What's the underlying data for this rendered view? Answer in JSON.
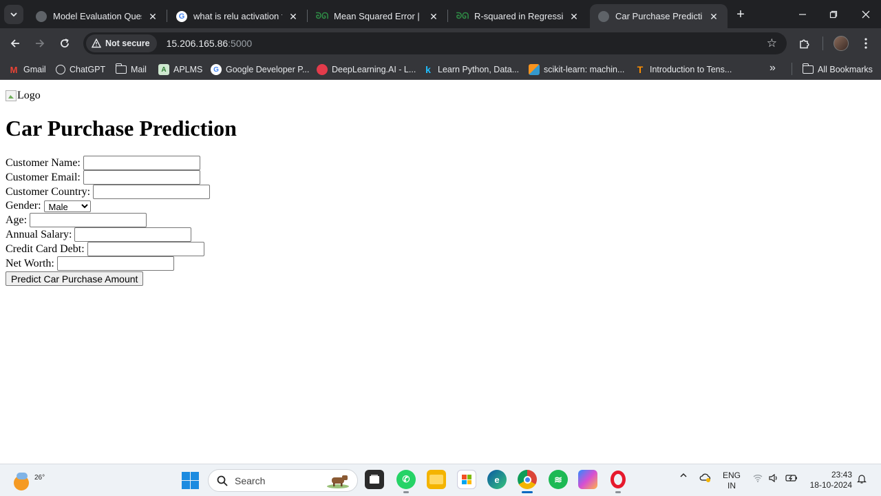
{
  "browser": {
    "tabs": [
      {
        "title": "Model Evaluation Questio",
        "favicon": "globe-icon"
      },
      {
        "title": "what is relu activation fur",
        "favicon": "google-icon"
      },
      {
        "title": "Mean Squared Error | Del",
        "favicon": "geeksforgeeks-icon"
      },
      {
        "title": "R-squared in Regression",
        "favicon": "geeksforgeeks-icon"
      },
      {
        "title": "Car Purchase Prediction",
        "favicon": "globe-icon",
        "active": true
      }
    ],
    "address": {
      "security_label": "Not secure",
      "host": "15.206.165.86",
      "port": ":5000"
    },
    "bookmarks": [
      {
        "label": "Gmail"
      },
      {
        "label": "ChatGPT"
      },
      {
        "label": "Mail"
      },
      {
        "label": "APLMS"
      },
      {
        "label": "Google Developer P..."
      },
      {
        "label": "DeepLearning.AI - L..."
      },
      {
        "label": "Learn Python, Data..."
      },
      {
        "label": "scikit-learn: machin..."
      },
      {
        "label": "Introduction to Tens..."
      }
    ],
    "all_bookmarks_label": "All Bookmarks"
  },
  "page": {
    "logo_alt": "Logo",
    "title": "Car Purchase Prediction",
    "form": {
      "customer_name_label": "Customer Name:",
      "customer_email_label": "Customer Email:",
      "customer_country_label": "Customer Country:",
      "gender_label": "Gender:",
      "gender_selected": "Male",
      "gender_options": [
        "Male"
      ],
      "age_label": "Age:",
      "annual_salary_label": "Annual Salary:",
      "credit_card_debt_label": "Credit Card Debt:",
      "net_worth_label": "Net Worth:",
      "submit_label": "Predict Car Purchase Amount"
    }
  },
  "taskbar": {
    "temperature": "26°",
    "search_placeholder": "Search",
    "language_line1": "ENG",
    "language_line2": "IN",
    "time": "23:43",
    "date": "18-10-2024"
  },
  "colors": {
    "chrome_dark": "#202124",
    "chrome_toolbar": "#35363a",
    "taskbar_bg": "#eef2f6",
    "accent_blue": "#0067c0"
  }
}
